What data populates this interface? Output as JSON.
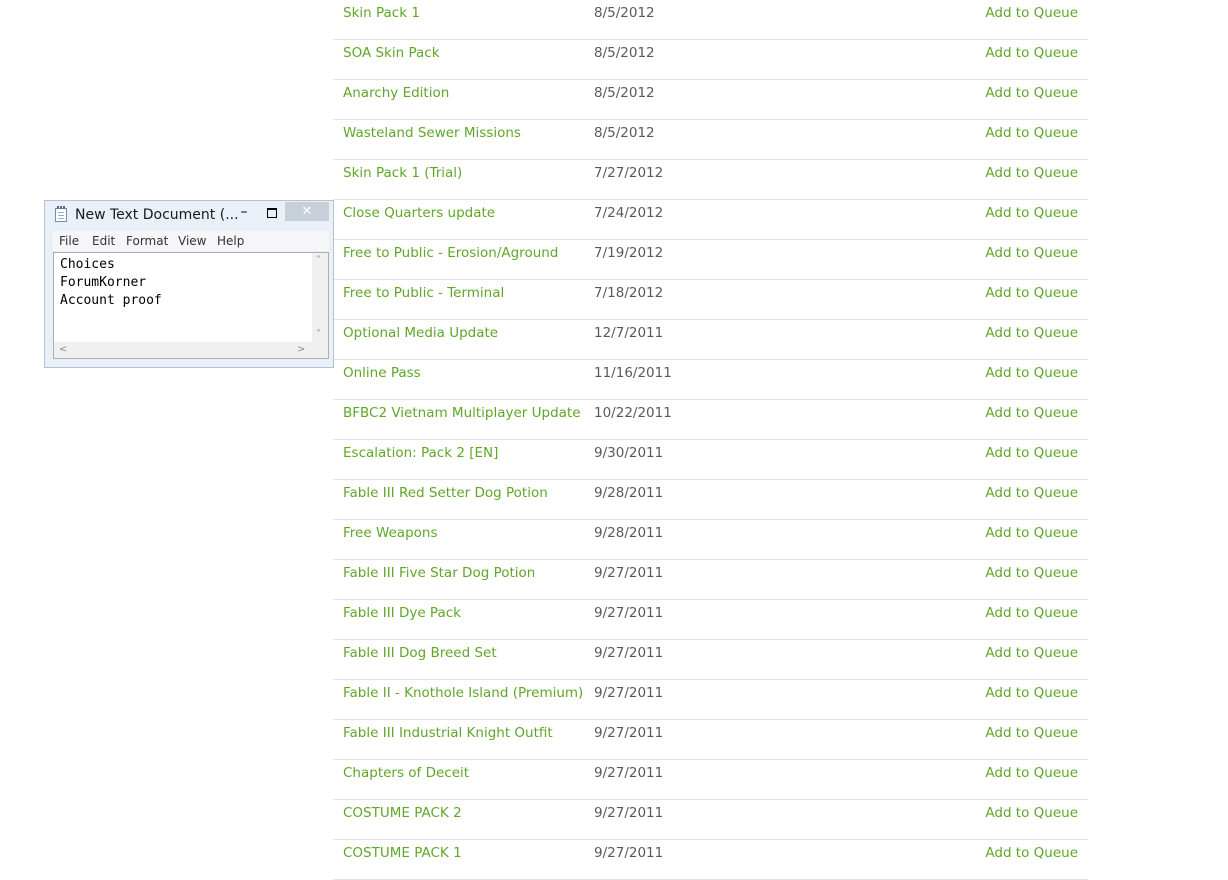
{
  "downloads": [
    {
      "name": "Skin Pack 1",
      "date": "8/5/2012",
      "action": "Add to Queue"
    },
    {
      "name": "SOA Skin Pack",
      "date": "8/5/2012",
      "action": "Add to Queue"
    },
    {
      "name": "Anarchy Edition",
      "date": "8/5/2012",
      "action": "Add to Queue"
    },
    {
      "name": "Wasteland Sewer Missions",
      "date": "8/5/2012",
      "action": "Add to Queue"
    },
    {
      "name": "Skin Pack 1 (Trial)",
      "date": "7/27/2012",
      "action": "Add to Queue"
    },
    {
      "name": "Close Quarters update",
      "date": "7/24/2012",
      "action": "Add to Queue"
    },
    {
      "name": "Free to Public - Erosion/Aground",
      "date": "7/19/2012",
      "action": "Add to Queue"
    },
    {
      "name": "Free to Public - Terminal",
      "date": "7/18/2012",
      "action": "Add to Queue"
    },
    {
      "name": "Optional Media Update",
      "date": "12/7/2011",
      "action": "Add to Queue"
    },
    {
      "name": "Online Pass",
      "date": "11/16/2011",
      "action": "Add to Queue"
    },
    {
      "name": "BFBC2 Vietnam Multiplayer Update",
      "date": "10/22/2011",
      "action": "Add to Queue"
    },
    {
      "name": "Escalation: Pack 2 [EN]",
      "date": "9/30/2011",
      "action": "Add to Queue"
    },
    {
      "name": "Fable III Red Setter Dog Potion",
      "date": "9/28/2011",
      "action": "Add to Queue"
    },
    {
      "name": "Free Weapons",
      "date": "9/28/2011",
      "action": "Add to Queue"
    },
    {
      "name": "Fable III Five Star Dog Potion",
      "date": "9/27/2011",
      "action": "Add to Queue"
    },
    {
      "name": "Fable III Dye Pack",
      "date": "9/27/2011",
      "action": "Add to Queue"
    },
    {
      "name": "Fable III Dog Breed Set",
      "date": "9/27/2011",
      "action": "Add to Queue"
    },
    {
      "name": "Fable II - Knothole Island (Premium)",
      "date": "9/27/2011",
      "action": "Add to Queue"
    },
    {
      "name": "Fable III Industrial Knight Outfit",
      "date": "9/27/2011",
      "action": "Add to Queue"
    },
    {
      "name": "Chapters of Deceit",
      "date": "9/27/2011",
      "action": "Add to Queue"
    },
    {
      "name": "COSTUME PACK 2",
      "date": "9/27/2011",
      "action": "Add to Queue"
    },
    {
      "name": "COSTUME PACK 1",
      "date": "9/27/2011",
      "action": "Add to Queue"
    }
  ],
  "notepad": {
    "title": "New Text Document (...",
    "minimize": "–",
    "close": "✕",
    "menu": [
      "File",
      "Edit",
      "Format",
      "View",
      "Help"
    ],
    "content": "Choices\nForumKorner\nAccount proof"
  },
  "colors": {
    "link_green": "#5fa728",
    "date_gray": "#595959",
    "divider": "#e3e3e3"
  }
}
